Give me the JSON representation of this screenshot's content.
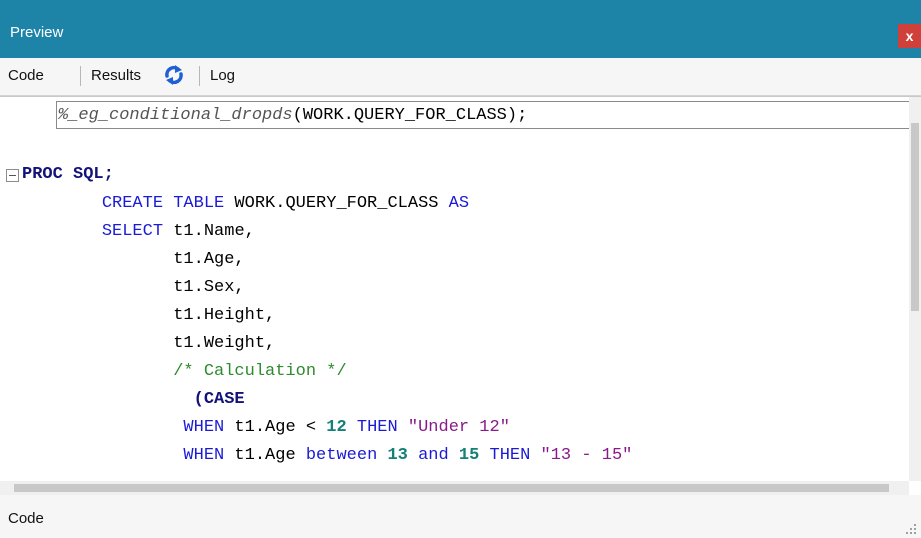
{
  "window": {
    "title": "Preview",
    "close_label": "x"
  },
  "toolbar": {
    "code_label": "Code",
    "results_label": "Results",
    "log_label": "Log",
    "refresh_icon": "refresh-icon"
  },
  "editor": {
    "lines": [
      [
        [
          "mac",
          "%_eg_conditional_dropds"
        ],
        [
          "",
          "(WORK.QUERY_FOR_CLASS);"
        ]
      ],
      [],
      [
        [
          "kwb",
          "PROC SQL;"
        ]
      ],
      [
        [
          "",
          "    "
        ],
        [
          "kw",
          "CREATE TABLE"
        ],
        [
          "",
          " WORK.QUERY_FOR_CLASS "
        ],
        [
          "kw",
          "AS"
        ]
      ],
      [
        [
          "",
          "    "
        ],
        [
          "kw",
          "SELECT"
        ],
        [
          "",
          " t1.Name,"
        ]
      ],
      [
        [
          "",
          "           t1.Age,"
        ]
      ],
      [
        [
          "",
          "           t1.Sex,"
        ]
      ],
      [
        [
          "",
          "           t1.Height,"
        ]
      ],
      [
        [
          "",
          "           t1.Weight,"
        ]
      ],
      [
        [
          "",
          "           "
        ],
        [
          "cmt",
          "/* Calculation */"
        ]
      ],
      [
        [
          "",
          "             "
        ],
        [
          "kwb",
          "(CASE"
        ]
      ],
      [
        [
          "",
          "            "
        ],
        [
          "kw",
          "WHEN"
        ],
        [
          "",
          " t1.Age < "
        ],
        [
          "num",
          "12"
        ],
        [
          "",
          " "
        ],
        [
          "kw",
          "THEN"
        ],
        [
          "",
          " "
        ],
        [
          "str",
          "\"Under 12\""
        ]
      ],
      [
        [
          "",
          "            "
        ],
        [
          "kw",
          "WHEN"
        ],
        [
          "",
          " t1.Age "
        ],
        [
          "kw",
          "between"
        ],
        [
          "",
          " "
        ],
        [
          "num",
          "13"
        ],
        [
          "",
          " "
        ],
        [
          "kw",
          "and"
        ],
        [
          "",
          " "
        ],
        [
          "num",
          "15"
        ],
        [
          "",
          " "
        ],
        [
          "kw",
          "THEN"
        ],
        [
          "",
          " "
        ],
        [
          "str",
          "\"13 - 15\""
        ]
      ]
    ]
  },
  "status": {
    "label": "Code"
  },
  "colors": {
    "titlebar": "#1d84a8",
    "close_button": "#d0403a",
    "keyword": "#1b1bd6",
    "number": "#148077",
    "string": "#8a1a8a",
    "comment": "#2e8b2e"
  }
}
